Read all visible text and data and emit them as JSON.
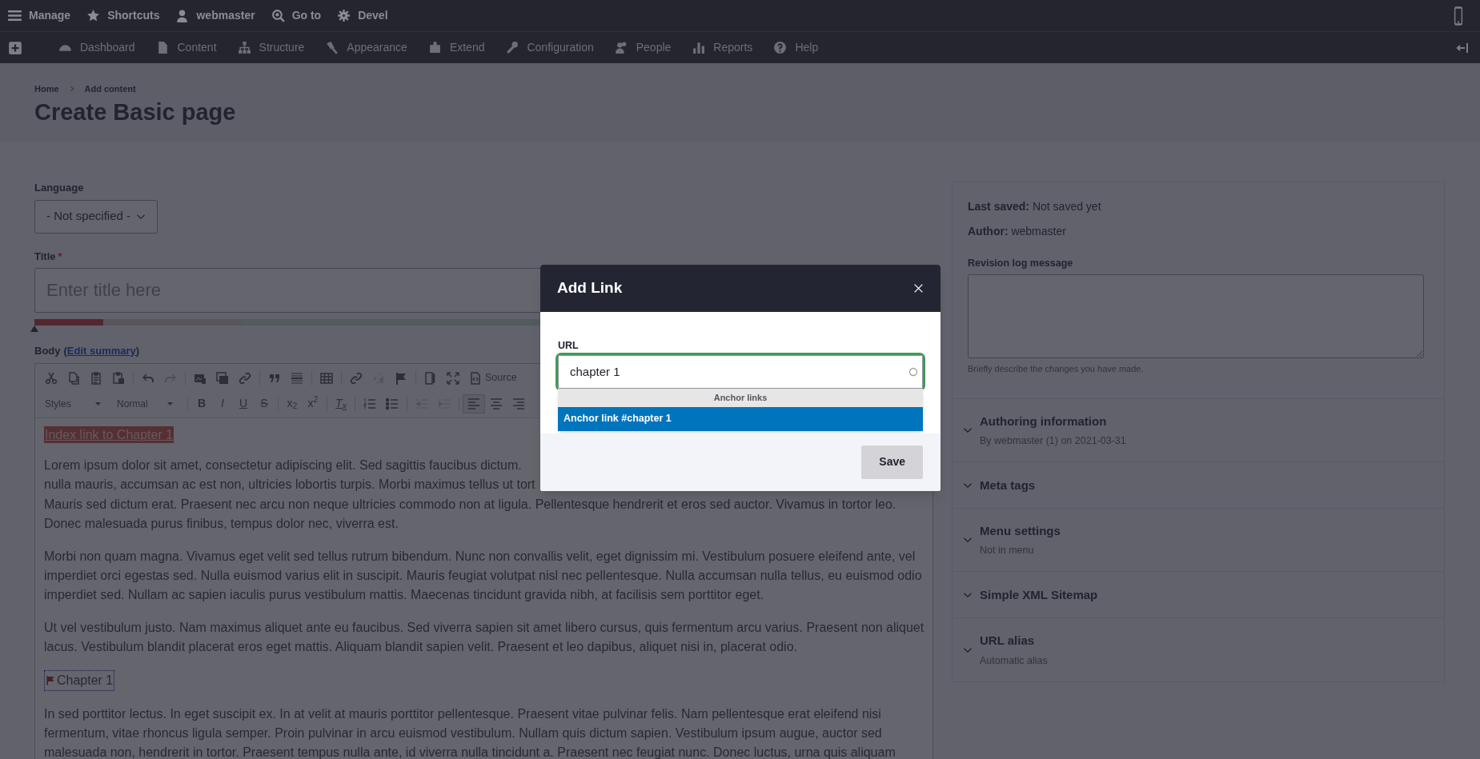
{
  "toolbar": {
    "items": [
      {
        "kind": "menu",
        "label": "Manage"
      },
      {
        "kind": "star",
        "label": "Shortcuts"
      },
      {
        "kind": "user",
        "label": "webmaster"
      },
      {
        "kind": "goto",
        "label": "Go to"
      },
      {
        "kind": "gear",
        "label": "Devel"
      }
    ]
  },
  "admin_menu": {
    "items": [
      {
        "kind": "dashboard",
        "label": "Dashboard"
      },
      {
        "kind": "content",
        "label": "Content"
      },
      {
        "kind": "structure",
        "label": "Structure"
      },
      {
        "kind": "appearance",
        "label": "Appearance"
      },
      {
        "kind": "extend",
        "label": "Extend"
      },
      {
        "kind": "configuration",
        "label": "Configuration"
      },
      {
        "kind": "people",
        "label": "People"
      },
      {
        "kind": "reports",
        "label": "Reports"
      },
      {
        "kind": "help",
        "label": "Help"
      }
    ]
  },
  "breadcrumb": [
    "Home",
    "Add content"
  ],
  "page_title": "Create Basic page",
  "language": {
    "label": "Language",
    "value": "- Not specified -"
  },
  "title_field": {
    "label": "Title",
    "required_mark": "*",
    "placeholder": "Enter title here",
    "score": {
      "level": 0
    }
  },
  "body": {
    "label": "Body",
    "open": "(",
    "link": "Edit summary",
    "close": ")",
    "toolbar": [
      [
        [
          {
            "kind": "cut",
            "disabled": false
          },
          {
            "kind": "copy",
            "disabled": false
          },
          {
            "kind": "paste",
            "disabled": false
          },
          {
            "kind": "paste-word",
            "disabled": false
          }
        ],
        [
          {
            "kind": "undo",
            "disabled": false
          },
          {
            "kind": "redo",
            "disabled": true
          }
        ],
        [
          {
            "kind": "image",
            "disabled": false
          },
          {
            "kind": "media",
            "disabled": false
          },
          {
            "kind": "link",
            "disabled": false
          }
        ],
        [
          {
            "kind": "quote",
            "disabled": false
          },
          {
            "kind": "rule",
            "disabled": false
          }
        ],
        [
          {
            "kind": "table",
            "disabled": false
          }
        ],
        [
          {
            "kind": "link",
            "disabled": false
          },
          {
            "kind": "unlink",
            "disabled": true
          },
          {
            "kind": "flag",
            "disabled": false
          }
        ],
        [
          {
            "kind": "template",
            "disabled": false
          },
          {
            "kind": "maximize",
            "disabled": false
          },
          {
            "kind": "source",
            "label": "Source",
            "disabled": false
          }
        ]
      ],
      [
        [
          {
            "kind": "dropdown",
            "label": "Styles"
          },
          {
            "kind": "dropdown",
            "label": "Normal"
          }
        ],
        [
          {
            "kind": "bold",
            "label": "B",
            "disabled": false
          },
          {
            "kind": "italic",
            "label": "I",
            "disabled": false
          },
          {
            "kind": "underline",
            "label": "U",
            "disabled": false
          },
          {
            "kind": "strike",
            "label": "S",
            "disabled": false
          }
        ],
        [
          {
            "kind": "subscript",
            "label": "x$_{2}$",
            "disabled": false
          },
          {
            "kind": "superscript",
            "label": "x$^{2}$",
            "disabled": false
          }
        ],
        [
          {
            "kind": "remove-format",
            "label": "T$_{x}$",
            "disabled": false
          }
        ],
        [
          {
            "kind": "numbered-list",
            "disabled": false
          },
          {
            "kind": "bulleted-list",
            "disabled": false
          }
        ],
        [
          {
            "kind": "outdent",
            "disabled": true
          },
          {
            "kind": "indent",
            "disabled": true
          }
        ],
        [
          {
            "kind": "align-left",
            "disabled": false,
            "active": true
          },
          {
            "kind": "align-center",
            "disabled": false,
            "active": false
          },
          {
            "kind": "align-right",
            "disabled": false,
            "active": false
          }
        ]
      ]
    ],
    "content": [
      {
        "kind": "selected-link",
        "text": "Index link to Chapter 1"
      },
      {
        "kind": "lines",
        "lines": [
          "Lorem ipsum dolor sit amet, consectetur adipiscing elit. Sed sagittis faucibus dictum.",
          "nulla mauris, accumsan ac est non, ultricies lobortis turpis. Morbi maximus tellus ut tort",
          "Mauris sed dictum erat. Praesent nec arcu non neque ultricies commodo non at ligula. Pellentesque hendrerit et eros sed auctor. Vivamus in tortor leo.",
          "Donec malesuada purus finibus, tempus dolor nec, viverra est."
        ]
      },
      {
        "kind": "paragraph",
        "text": "Morbi non quam magna. Vivamus eget velit sed tellus rutrum bibendum. Nunc non convallis velit, eget dignissim mi. Vestibulum posuere eleifend ante, vel imperdiet orci egestas sed. Nulla euismod varius elit in suscipit. Mauris feugiat volutpat nisl nec pellentesque. Nulla accumsan nulla tellus, eu euismod odio imperdiet sed. Nullam ac sapien iaculis purus vestibulum mattis. Maecenas tincidunt gravida nibh, at facilisis sem porttitor eget."
      },
      {
        "kind": "paragraph",
        "text": "Ut vel vestibulum justo. Nam maximus aliquet ante eu faucibus. Sed viverra sapien sit amet libero cursus, quis fermentum arcu varius. Praesent non aliquet lacus. Vestibulum blandit placerat eros eget mattis. Aliquam blandit sapien velit. Praesent et leo dapibus, aliquet nisi in, placerat odio."
      },
      {
        "kind": "anchor",
        "text": "Chapter 1"
      },
      {
        "kind": "paragraph",
        "text": "In sed porttitor lectus. In eget suscipit ex. In at velit at mauris porttitor pellentesque. Praesent vitae pulvinar felis. Nam pellentesque erat eleifend nisi fermentum, vitae rhoncus ligula semper. Proin pulvinar in arcu euismod vestibulum. Nullam quis dictum sapien. Vestibulum ipsum augue, auctor sed malesuada non, hendrerit in tortor. Praesent tempus nulla ante, id viverra nulla tincidunt a. Praesent nec feugiat nunc. Donec luctus, urna quis aliquam"
      }
    ]
  },
  "sidebar": {
    "meta": [
      {
        "label": "Last saved:",
        "value": "Not saved yet"
      },
      {
        "label": "Author:",
        "value": "webmaster"
      }
    ],
    "revision": {
      "label": "Revision log message",
      "hint": "Briefly describe the changes you have made."
    },
    "sections": [
      {
        "title": "Authoring information",
        "summary": "By webmaster (1) on 2021-03-31",
        "expanded": false
      },
      {
        "title": "Meta tags",
        "expanded": false
      },
      {
        "title": "Menu settings",
        "summary": "Not in menu",
        "expanded": false
      },
      {
        "title": "Simple XML Sitemap",
        "expanded": false
      },
      {
        "title": "URL alias",
        "summary": "Automatic alias",
        "expanded": false
      }
    ]
  },
  "dialog": {
    "title": "Add Link",
    "url_label": "URL",
    "url_value": "chapter 1",
    "autocomplete": {
      "group": "Anchor links",
      "items": [
        {
          "label": "Anchor link #chapter 1",
          "selected": true
        }
      ]
    },
    "buttons": [
      "Save"
    ]
  }
}
